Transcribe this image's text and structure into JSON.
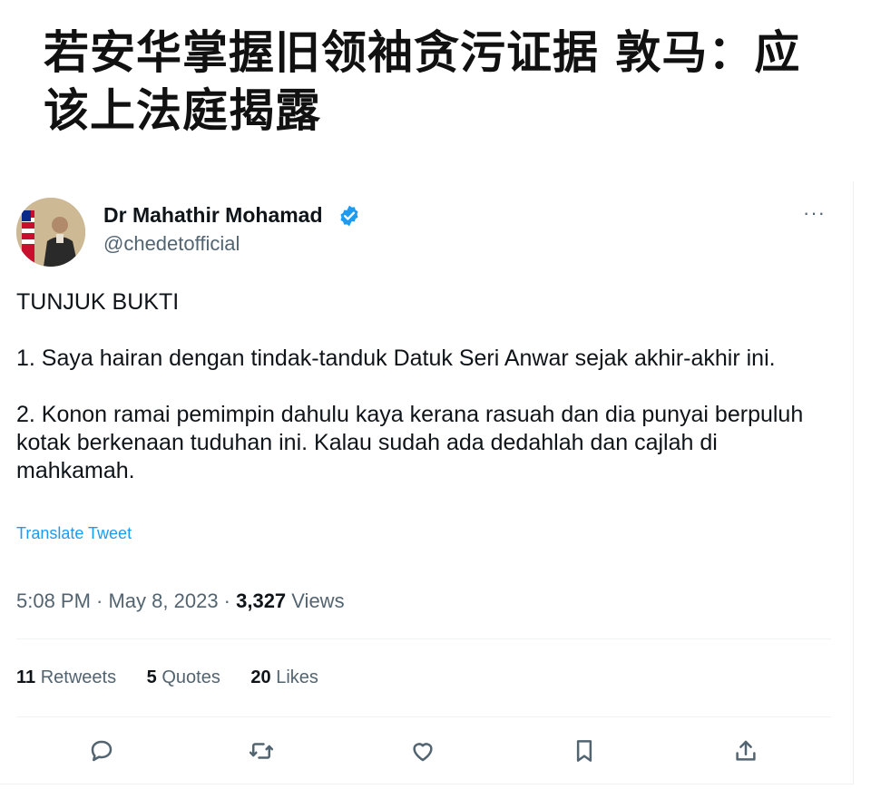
{
  "headline": "若安华掌握旧领袖贪污证据 敦马：应该上法庭揭露",
  "tweet": {
    "author_name": "Dr Mahathir Mohamad",
    "handle": "@chedetofficial",
    "verified": true,
    "more_label": "···",
    "paragraphs": [
      "TUNJUK BUKTI",
      "1. Saya hairan dengan tindak-tanduk Datuk Seri Anwar sejak akhir-akhir ini.",
      "2. Konon ramai pemimpin dahulu kaya kerana rasuah dan dia punyai berpuluh kotak berkenaan tuduhan ini. Kalau sudah ada dedahlah dan cajlah di mahkamah."
    ],
    "translate_label": "Translate Tweet",
    "timestamp": "5:08 PM · May 8, 2023 · ",
    "views_count": "3,327",
    "views_label": " Views",
    "stats": {
      "retweets_count": "11",
      "retweets_label": " Retweets",
      "quotes_count": "5",
      "quotes_label": " Quotes",
      "likes_count": "20",
      "likes_label": " Likes"
    },
    "actions": [
      "reply-icon",
      "retweet-icon",
      "like-icon",
      "bookmark-icon",
      "share-icon"
    ]
  },
  "colors": {
    "link": "#1d9bf0",
    "secondary_text": "#536471",
    "primary_text": "#0f1419",
    "verified_badge": "#1d9bf0"
  }
}
